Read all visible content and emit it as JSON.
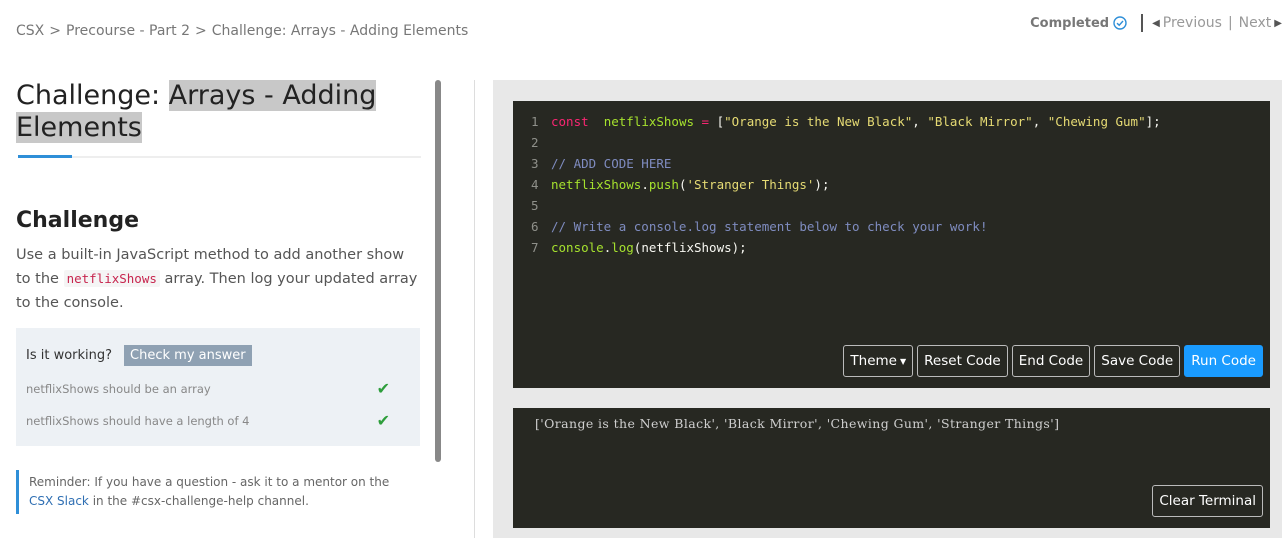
{
  "breadcrumb": {
    "items": [
      "CSX",
      "Precourse - Part 2",
      "Challenge: Arrays - Adding Elements"
    ],
    "separator": ">"
  },
  "topnav": {
    "completed_label": "Completed",
    "previous_label": "Previous",
    "next_label": "Next",
    "nav_separator": "|"
  },
  "page": {
    "title_prefix": "Challenge: ",
    "title_highlight_line1": "Arrays - Adding ",
    "title_highlight_line2": "Elements"
  },
  "challenge": {
    "heading": "Challenge",
    "desc_part1": "Use a built-in JavaScript method to add another show to the ",
    "desc_code": "netflixShows",
    "desc_part2": " array. Then log your updated array to the console."
  },
  "checks": {
    "label": "Is it working?",
    "button_label": "Check my answer",
    "tests": [
      {
        "text": "netflixShows should be an array",
        "status": "✔"
      },
      {
        "text": "netflixShows should have a length of 4",
        "status": "✔"
      }
    ]
  },
  "reminder": {
    "text_before": "Reminder: If you have a question - ask it to a mentor on the ",
    "link_label": "CSX Slack",
    "text_after": " in the #csx-challenge-help channel."
  },
  "editor": {
    "line_numbers": [
      "1",
      "2",
      "3",
      "4",
      "5",
      "6",
      "7"
    ],
    "l1_kw": "const",
    "l1_var": "netflixShows",
    "l1_op": " = ",
    "l1_open": "[",
    "l1_s1": "\"Orange is the New Black\"",
    "l1_s2": "\"Black Mirror\"",
    "l1_s3": "\"Chewing Gum\"",
    "l1_close": "];",
    "l3_comment": "// ADD CODE HERE",
    "l4_obj": "netflixShows",
    "l4_dot": ".",
    "l4_fn": "push",
    "l4_open": "(",
    "l4_str": "'Stranger Things'",
    "l4_close": ");",
    "l6_comment": "// Write a console.log statement below to check your work!",
    "l7_obj": "console",
    "l7_dot": ".",
    "l7_fn": "log",
    "l7_args": "(netflixShows);",
    "buttons": {
      "theme": "Theme",
      "reset": "Reset Code",
      "end": "End Code",
      "save": "Save Code",
      "run": "Run Code"
    }
  },
  "terminal": {
    "output": "['Orange is the New Black', 'Black Mirror', 'Chewing Gum', 'Stranger Things']",
    "clear_label": "Clear Terminal"
  },
  "colors": {
    "accent": "#2f8fd8",
    "run_button": "#1a9bff",
    "editor_bg": "#272822",
    "check_green": "#2e9e3c"
  }
}
